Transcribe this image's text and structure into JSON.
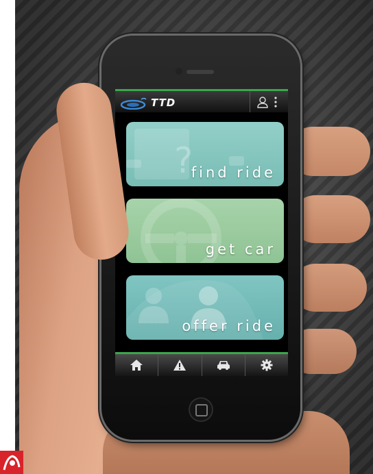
{
  "app": {
    "logo_text": "TTD"
  },
  "tiles": [
    {
      "label": "find ride",
      "icon": "question-passenger-icon"
    },
    {
      "label": "get car",
      "icon": "steering-wheel-icon"
    },
    {
      "label": "offer ride",
      "icon": "passengers-icon"
    }
  ],
  "bottom_nav": [
    {
      "icon": "home-icon"
    },
    {
      "icon": "warning-icon"
    },
    {
      "icon": "car-icon"
    },
    {
      "icon": "gear-icon"
    }
  ],
  "colors": {
    "accent_green": "#3aa84a",
    "tile_find": "#84c6c0",
    "tile_car": "#9acb9f",
    "tile_offer": "#72bbb8"
  }
}
